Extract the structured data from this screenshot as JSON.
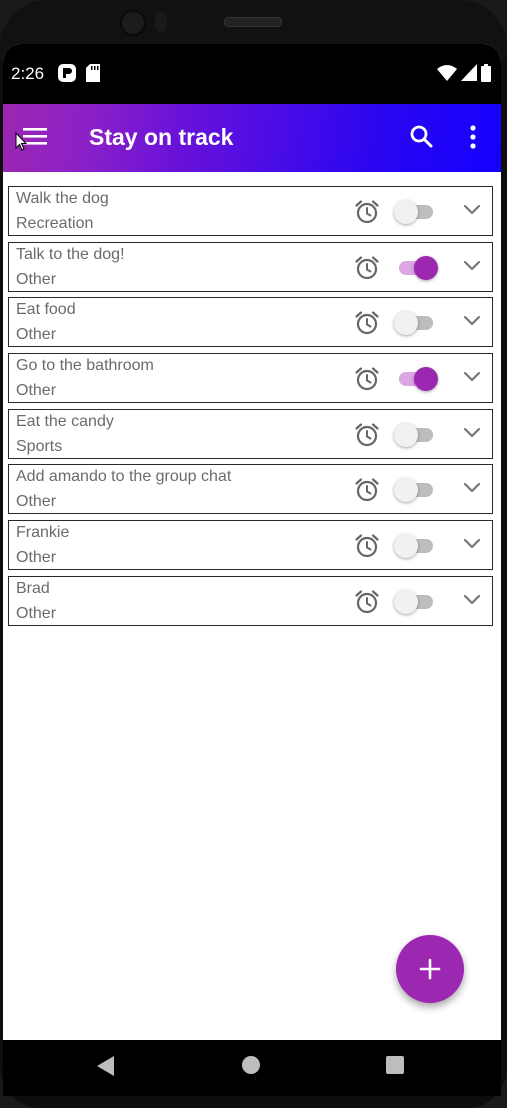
{
  "status_bar": {
    "time": "2:26"
  },
  "app_bar": {
    "title": "Stay on track"
  },
  "tasks": [
    {
      "title": "Walk the dog",
      "category": "Recreation",
      "alarm_on": false
    },
    {
      "title": "Talk to the dog!",
      "category": "Other",
      "alarm_on": true
    },
    {
      "title": "Eat food",
      "category": "Other",
      "alarm_on": false
    },
    {
      "title": "Go to the bathroom",
      "category": "Other",
      "alarm_on": true
    },
    {
      "title": "Eat the candy",
      "category": "Sports",
      "alarm_on": false
    },
    {
      "title": "Add amando to the group chat",
      "category": "Other",
      "alarm_on": false
    },
    {
      "title": "Frankie",
      "category": "Other",
      "alarm_on": false
    },
    {
      "title": "Brad",
      "category": "Other",
      "alarm_on": false
    }
  ],
  "icons": {
    "menu": "menu-icon",
    "search": "search-icon",
    "more": "more-vert-icon",
    "alarm": "alarm-clock-icon",
    "expand": "chevron-down-icon",
    "add": "plus-icon",
    "back": "back-icon",
    "home": "home-icon",
    "recents": "recents-icon"
  },
  "colors": {
    "accent": "#9c27b0",
    "appbar_gradient": [
      "#9c27b0",
      "#1400ff"
    ],
    "switch_track_on": "#dca6e4",
    "switch_track_off": "#bdbdbd"
  }
}
